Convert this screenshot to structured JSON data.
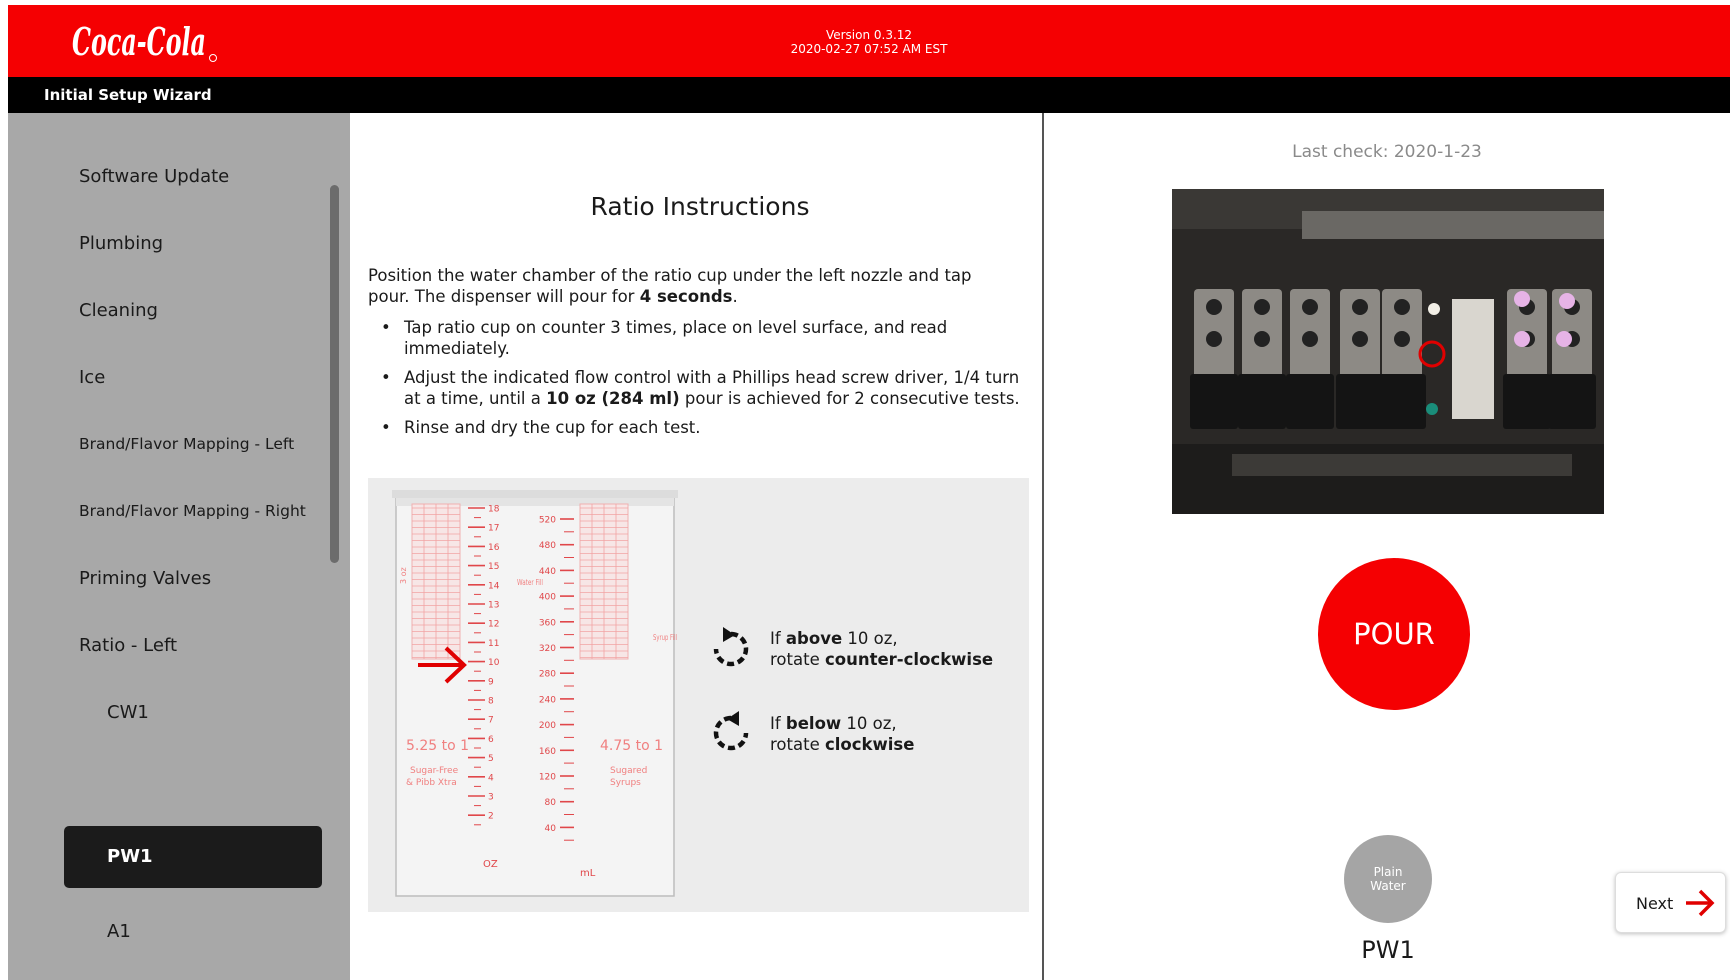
{
  "header": {
    "logo_text": "Coca-Cola",
    "version": "Version 0.3.12",
    "datetime": "2020-02-27 07:52 AM EST",
    "wizard_title": "Initial Setup Wizard"
  },
  "sidebar": {
    "items": [
      {
        "label": "Software Update"
      },
      {
        "label": "Plumbing"
      },
      {
        "label": "Cleaning"
      },
      {
        "label": "Ice"
      },
      {
        "label": "Brand/Flavor Mapping - Left"
      },
      {
        "label": "Brand/Flavor Mapping - Right"
      },
      {
        "label": "Priming Valves"
      },
      {
        "label": "Ratio - Left"
      },
      {
        "label": "CW1"
      },
      {
        "label": "PW1",
        "active": true
      },
      {
        "label": "A1"
      }
    ]
  },
  "main": {
    "title": "Ratio Instructions",
    "intro_prefix": "Position the water chamber of the ratio cup under the left nozzle and tap pour. The dispenser will pour for ",
    "intro_bold": "4 seconds",
    "intro_suffix": ".",
    "bullets": [
      {
        "pre": "Tap ratio cup on counter 3 times, place on level surface, and read immediately.",
        "bold": "",
        "post": ""
      },
      {
        "pre": "Adjust the indicated flow control with a Phillips head screw driver, 1/4 turn at a time, until a ",
        "bold": "10 oz (284 ml)",
        "post": " pour is achieved for 2 consecutive tests."
      },
      {
        "pre": "Rinse and dry the cup for each test.",
        "bold": "",
        "post": ""
      }
    ],
    "above": {
      "pre": "If ",
      "bold1": "above",
      "mid": " 10 oz,",
      "line2_pre": "rotate ",
      "bold2": "counter-clockwise"
    },
    "below": {
      "pre": "If ",
      "bold1": "below",
      "mid": " 10 oz,",
      "line2_pre": "rotate ",
      "bold2": "clockwise"
    }
  },
  "cup": {
    "oz_ticks": [
      "18",
      "17",
      "16",
      "15",
      "14",
      "13",
      "12",
      "11",
      "10",
      "9",
      "8",
      "7",
      "6",
      "5",
      "4",
      "3",
      "2"
    ],
    "ml_ticks": [
      "520",
      "480",
      "440",
      "400",
      "360",
      "320",
      "280",
      "240",
      "200",
      "160",
      "120",
      "80",
      "40"
    ],
    "oz_unit": "OZ",
    "ml_unit": "mL",
    "left_ratio": "5.25 to 1",
    "left_desc1": "Sugar-Free",
    "left_desc2": "& Pibb Xtra",
    "right_ratio": "4.75 to 1",
    "right_desc1": "Sugared",
    "right_desc2": "Syrups",
    "water_fill": "Water Fill",
    "syrup_fill": "Syrup Fill",
    "side_mark": "3 oz"
  },
  "right": {
    "last_check": "Last check: 2020-1-23",
    "pour_label": "POUR",
    "plain_water_line1": "Plain",
    "plain_water_line2": "Water",
    "valve_label": "PW1"
  },
  "footer": {
    "next_label": "Next"
  },
  "colors": {
    "brand_red": "#f50002",
    "sidebar_bg": "#a8a8a8",
    "active_bg": "#1b1b1b",
    "cup_marks": "#e0474a"
  }
}
